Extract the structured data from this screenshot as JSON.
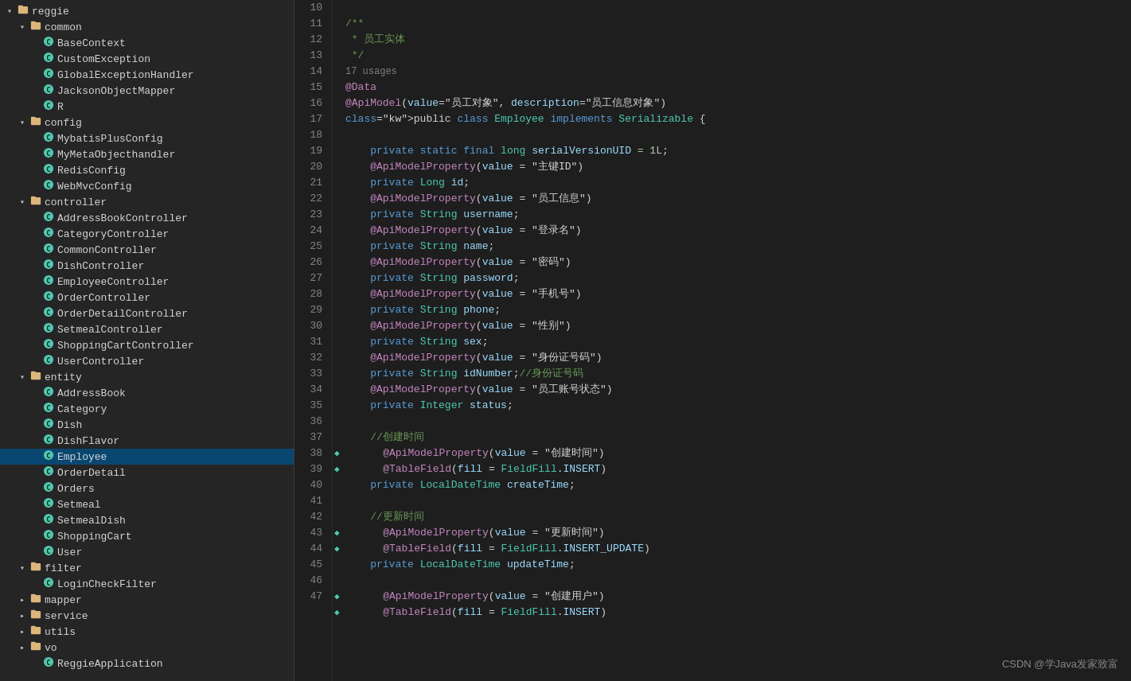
{
  "sidebar": {
    "items": [
      {
        "id": "reggie",
        "label": "reggie",
        "level": 0,
        "type": "folder-open",
        "expanded": true
      },
      {
        "id": "common",
        "label": "common",
        "level": 1,
        "type": "folder-open",
        "expanded": true
      },
      {
        "id": "BaseContext",
        "label": "BaseContext",
        "level": 2,
        "type": "class"
      },
      {
        "id": "CustomException",
        "label": "CustomException",
        "level": 2,
        "type": "class"
      },
      {
        "id": "GlobalExceptionHandler",
        "label": "GlobalExceptionHandler",
        "level": 2,
        "type": "class"
      },
      {
        "id": "JacksonObjectMapper",
        "label": "JacksonObjectMapper",
        "level": 2,
        "type": "class"
      },
      {
        "id": "R",
        "label": "R",
        "level": 2,
        "type": "class"
      },
      {
        "id": "config",
        "label": "config",
        "level": 1,
        "type": "folder-open",
        "expanded": true
      },
      {
        "id": "MybatisPlusConfig",
        "label": "MybatisPlusConfig",
        "level": 2,
        "type": "class"
      },
      {
        "id": "MyMetaObjecthandler",
        "label": "MyMetaObjecthandler",
        "level": 2,
        "type": "class"
      },
      {
        "id": "RedisConfig",
        "label": "RedisConfig",
        "level": 2,
        "type": "class"
      },
      {
        "id": "WebMvcConfig",
        "label": "WebMvcConfig",
        "level": 2,
        "type": "class"
      },
      {
        "id": "controller",
        "label": "controller",
        "level": 1,
        "type": "folder-open",
        "expanded": true
      },
      {
        "id": "AddressBookController",
        "label": "AddressBookController",
        "level": 2,
        "type": "class"
      },
      {
        "id": "CategoryController",
        "label": "CategoryController",
        "level": 2,
        "type": "class"
      },
      {
        "id": "CommonController",
        "label": "CommonController",
        "level": 2,
        "type": "class"
      },
      {
        "id": "DishController",
        "label": "DishController",
        "level": 2,
        "type": "class"
      },
      {
        "id": "EmployeeController",
        "label": "EmployeeController",
        "level": 2,
        "type": "class"
      },
      {
        "id": "OrderController",
        "label": "OrderController",
        "level": 2,
        "type": "class"
      },
      {
        "id": "OrderDetailController",
        "label": "OrderDetailController",
        "level": 2,
        "type": "class"
      },
      {
        "id": "SetmealController",
        "label": "SetmealController",
        "level": 2,
        "type": "class"
      },
      {
        "id": "ShoppingCartController",
        "label": "ShoppingCartController",
        "level": 2,
        "type": "class"
      },
      {
        "id": "UserController",
        "label": "UserController",
        "level": 2,
        "type": "class"
      },
      {
        "id": "entity",
        "label": "entity",
        "level": 1,
        "type": "folder-open",
        "expanded": true
      },
      {
        "id": "AddressBook",
        "label": "AddressBook",
        "level": 2,
        "type": "class"
      },
      {
        "id": "Category",
        "label": "Category",
        "level": 2,
        "type": "class"
      },
      {
        "id": "Dish",
        "label": "Dish",
        "level": 2,
        "type": "class"
      },
      {
        "id": "DishFlavor",
        "label": "DishFlavor",
        "level": 2,
        "type": "class"
      },
      {
        "id": "Employee",
        "label": "Employee",
        "level": 2,
        "type": "class",
        "selected": true
      },
      {
        "id": "OrderDetail",
        "label": "OrderDetail",
        "level": 2,
        "type": "class"
      },
      {
        "id": "Orders",
        "label": "Orders",
        "level": 2,
        "type": "class"
      },
      {
        "id": "Setmeal",
        "label": "Setmeal",
        "level": 2,
        "type": "class"
      },
      {
        "id": "SetmealDish",
        "label": "SetmealDish",
        "level": 2,
        "type": "class"
      },
      {
        "id": "ShoppingCart",
        "label": "ShoppingCart",
        "level": 2,
        "type": "class"
      },
      {
        "id": "User",
        "label": "User",
        "level": 2,
        "type": "class"
      },
      {
        "id": "filter",
        "label": "filter",
        "level": 1,
        "type": "folder-open",
        "expanded": true
      },
      {
        "id": "LoginCheckFilter",
        "label": "LoginCheckFilter",
        "level": 2,
        "type": "class"
      },
      {
        "id": "mapper",
        "label": "mapper",
        "level": 1,
        "type": "folder",
        "expanded": false
      },
      {
        "id": "service",
        "label": "service",
        "level": 1,
        "type": "folder",
        "expanded": false
      },
      {
        "id": "utils",
        "label": "utils",
        "level": 1,
        "type": "folder",
        "expanded": false
      },
      {
        "id": "vo",
        "label": "vo",
        "level": 1,
        "type": "folder",
        "expanded": false
      },
      {
        "id": "ReggieApplication",
        "label": "ReggieApplication",
        "level": 2,
        "type": "class"
      }
    ]
  },
  "editor": {
    "lines": [
      {
        "num": 10,
        "content": ""
      },
      {
        "num": 11,
        "content": "/**"
      },
      {
        "num": 12,
        "content": " * 员工实体"
      },
      {
        "num": 13,
        "content": " */"
      },
      {
        "num": 14,
        "content": "@Data"
      },
      {
        "num": 15,
        "content": "@ApiModel(value=\"员工对象\", description=\"员工信息对象\")"
      },
      {
        "num": 16,
        "content": "public class Employee implements Serializable {"
      },
      {
        "num": 17,
        "content": ""
      },
      {
        "num": 18,
        "content": "    private static final long serialVersionUID = 1L;"
      },
      {
        "num": 19,
        "content": "    @ApiModelProperty(value = \"主键ID\")"
      },
      {
        "num": 20,
        "content": "    private Long id;"
      },
      {
        "num": 21,
        "content": "    @ApiModelProperty(value = \"员工信息\")"
      },
      {
        "num": 22,
        "content": "    private String username;"
      },
      {
        "num": 23,
        "content": "    @ApiModelProperty(value = \"登录名\")"
      },
      {
        "num": 24,
        "content": "    private String name;"
      },
      {
        "num": 25,
        "content": "    @ApiModelProperty(value = \"密码\")"
      },
      {
        "num": 26,
        "content": "    private String password;"
      },
      {
        "num": 27,
        "content": "    @ApiModelProperty(value = \"手机号\")"
      },
      {
        "num": 28,
        "content": "    private String phone;"
      },
      {
        "num": 29,
        "content": "    @ApiModelProperty(value = \"性别\")"
      },
      {
        "num": 30,
        "content": "    private String sex;"
      },
      {
        "num": 31,
        "content": "    @ApiModelProperty(value = \"身份证号码\")"
      },
      {
        "num": 32,
        "content": "    private String idNumber;//身份证号码"
      },
      {
        "num": 33,
        "content": "    @ApiModelProperty(value = \"员工账号状态\")"
      },
      {
        "num": 34,
        "content": "    private Integer status;"
      },
      {
        "num": 35,
        "content": ""
      },
      {
        "num": 36,
        "content": "    //创建时间"
      },
      {
        "num": 37,
        "content": "    @ApiModelProperty(value = \"创建时间\")"
      },
      {
        "num": 38,
        "content": "    @TableField(fill = FieldFill.INSERT)"
      },
      {
        "num": 39,
        "content": "    private LocalDateTime createTime;"
      },
      {
        "num": 40,
        "content": ""
      },
      {
        "num": 41,
        "content": "    //更新时间"
      },
      {
        "num": 42,
        "content": "    @ApiModelProperty(value = \"更新时间\")"
      },
      {
        "num": 43,
        "content": "    @TableField(fill = FieldFill.INSERT_UPDATE)"
      },
      {
        "num": 44,
        "content": "    private LocalDateTime updateTime;"
      },
      {
        "num": 45,
        "content": ""
      },
      {
        "num": 46,
        "content": "    @ApiModelProperty(value = \"创建用户\")"
      },
      {
        "num": 47,
        "content": "    @TableField(fill = FieldFill.INSERT)"
      }
    ],
    "usages_line": 14,
    "usages_text": "17 usages"
  },
  "watermark": "CSDN @学Java发家致富"
}
